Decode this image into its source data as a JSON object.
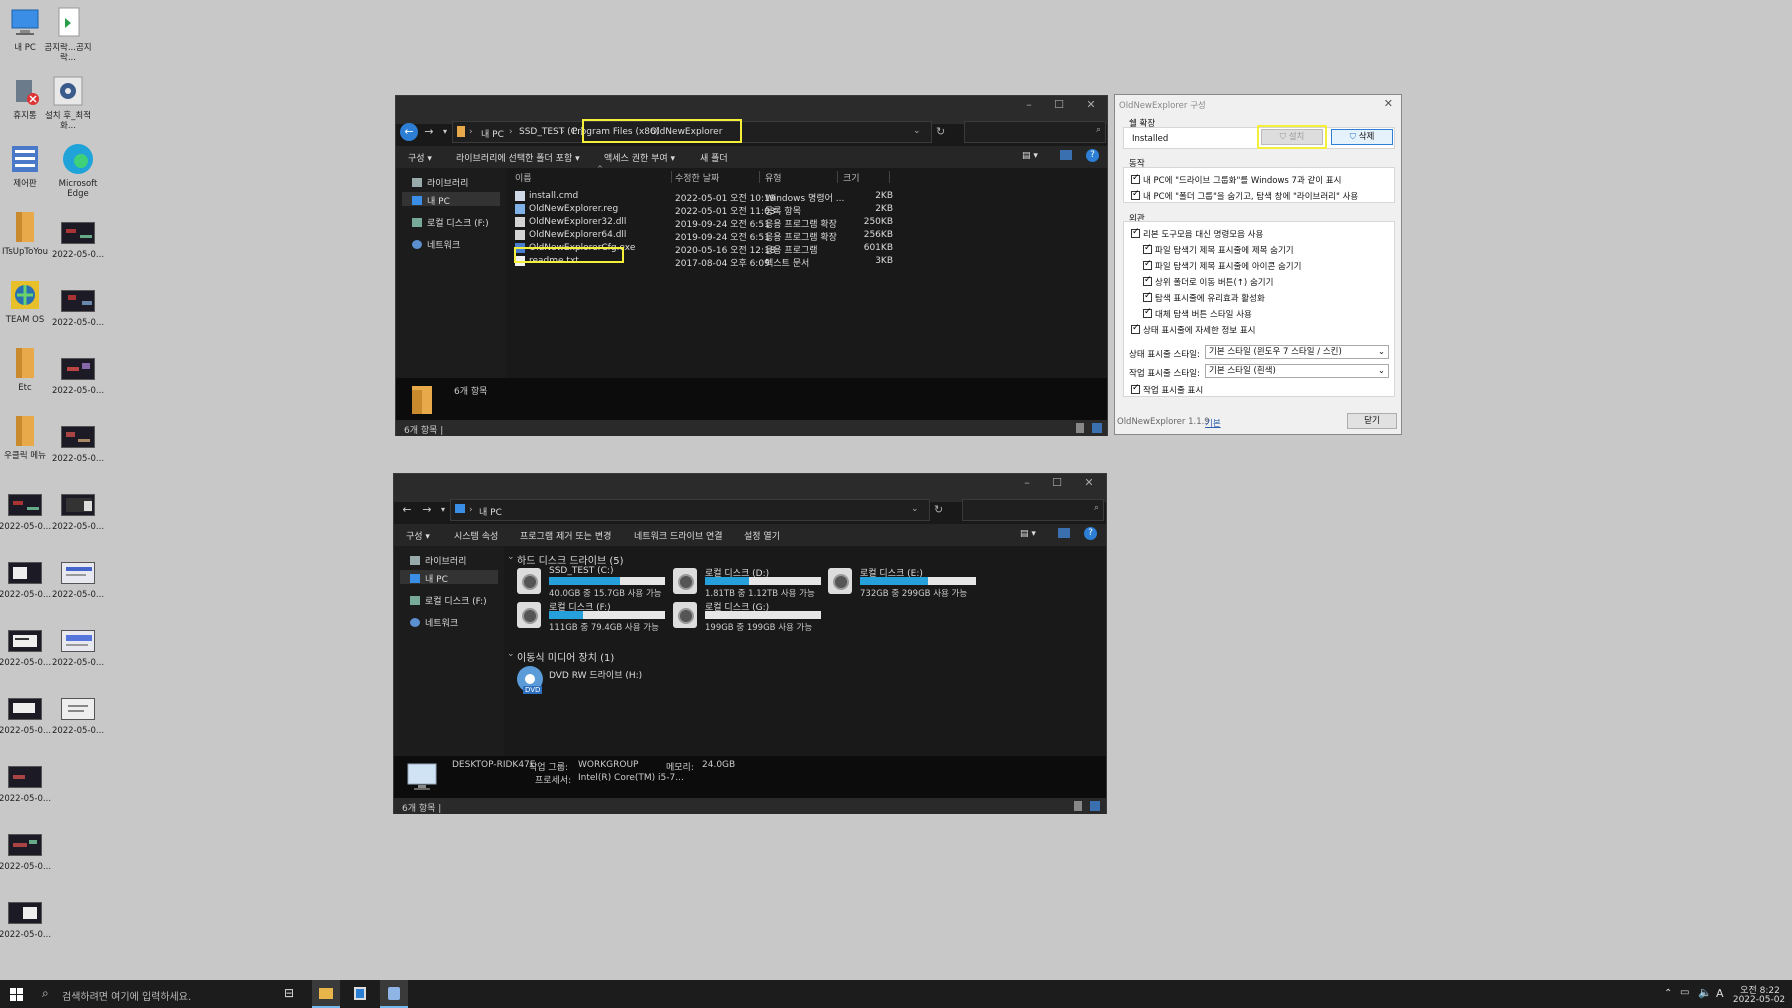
{
  "desktop": {
    "icons": [
      {
        "label": "내 PC",
        "icon": "pc-icon"
      },
      {
        "label": "곰지락...곰지락...",
        "icon": "shortcut-file-icon"
      },
      {
        "label": "휴지통",
        "icon": "recycle-bin-icon"
      },
      {
        "label": "설치 후_최적화...",
        "icon": "settings-icon"
      },
      {
        "label": "제어판",
        "icon": "control-panel-icon"
      },
      {
        "label": "Microsoft Edge",
        "icon": "edge-icon"
      },
      {
        "label": "ITsUpToYou",
        "icon": "folder-icon"
      },
      {
        "label": "TEAM OS",
        "icon": "globe-icon"
      },
      {
        "label": "Etc",
        "icon": "folder-icon"
      },
      {
        "label": "우클릭 메뉴",
        "icon": "folder-icon"
      }
    ],
    "thumb_label": "2022-05-0..."
  },
  "explorer1": {
    "breadcrumb": [
      "내 PC",
      "SSD_TEST (C:)",
      "Program Files (x86)",
      "OldNewExplorer"
    ],
    "toolbar": [
      "구성 ▾",
      "라이브러리에 선택한 폴더 포함 ▾",
      "액세스 권한 부여 ▾",
      "새 폴더"
    ],
    "nav": [
      "라이브러리",
      "내 PC",
      "로컬 디스크 (F:)",
      "네트워크"
    ],
    "columns": {
      "name": "이름",
      "date": "수정한 날짜",
      "type": "유형",
      "size": "크기"
    },
    "files": [
      {
        "name": "install.cmd",
        "date": "2022-05-01 오전 10:19",
        "type": "Windows 명령어 ...",
        "size": "2KB"
      },
      {
        "name": "OldNewExplorer.reg",
        "date": "2022-05-01 오전 11:03",
        "type": "등록 항목",
        "size": "2KB"
      },
      {
        "name": "OldNewExplorer32.dll",
        "date": "2019-09-24 오전 6:51",
        "type": "응용 프로그램 확장",
        "size": "250KB"
      },
      {
        "name": "OldNewExplorer64.dll",
        "date": "2019-09-24 오전 6:51",
        "type": "응용 프로그램 확장",
        "size": "256KB"
      },
      {
        "name": "OldNewExplorerCfg.exe",
        "date": "2020-05-16 오전 12:18",
        "type": "응용 프로그램",
        "size": "601KB"
      },
      {
        "name": "readme.txt",
        "date": "2017-08-04 오후 6:09",
        "type": "텍스트 문서",
        "size": "3KB"
      }
    ],
    "details_text": "6개 항목",
    "status": "6개 항목  |"
  },
  "explorer2": {
    "breadcrumb": [
      "내 PC"
    ],
    "toolbar": [
      "구성 ▾",
      "시스템 속성",
      "프로그램 제거 또는 변경",
      "네트워크 드라이브 연결",
      "설정 열기"
    ],
    "nav": [
      "라이브러리",
      "내 PC",
      "로컬 디스크 (F:)",
      "네트워크"
    ],
    "hdd_header": "하드 디스크 드라이브 (5)",
    "removable_header": "이동식 미디어 장치 (1)",
    "drives": [
      {
        "name": "SSD_TEST (C:)",
        "cap": "40.0GB 중 15.7GB 사용 가능",
        "used": 0.61
      },
      {
        "name": "로컬 디스크 (D:)",
        "cap": "1.81TB 중 1.12TB 사용 가능",
        "used": 0.38
      },
      {
        "name": "로컬 디스크 (E:)",
        "cap": "732GB 중 299GB 사용 가능",
        "used": 0.59
      },
      {
        "name": "로컬 디스크 (F:)",
        "cap": "111GB 중 79.4GB 사용 가능",
        "used": 0.29
      },
      {
        "name": "로컬 디스크 (G:)",
        "cap": "199GB 중 199GB 사용 가능",
        "used": 0.0
      }
    ],
    "dvd": "DVD RW 드라이브 (H:)",
    "dvd_badge": "DVD",
    "pc_name": "DESKTOP-RIDK47E",
    "workgroup_label": "작업 그룹:",
    "workgroup": "WORKGROUP",
    "memory_label": "메모리:",
    "memory": "24.0GB",
    "cpu_label": "프로세서:",
    "cpu": "Intel(R) Core(TM) i5-7...",
    "status": "6개 항목  |"
  },
  "cfg": {
    "title": "OldNewExplorer 구성",
    "shell_group": "쉘 확장",
    "installed": "Installed",
    "install_btn": "설치",
    "uninstall_btn": "삭제",
    "behavior_group": "동작",
    "behavior": [
      "내 PC에 \"드라이브 그룹화\"를 Windows 7과 같이 표시",
      "내 PC에 \"폴더 그룹\"을 숨기고, 탐색 창에 \"라이브러리\" 사용"
    ],
    "look_group": "외관",
    "look_main": "리본 도구모음 대신 명령모음 사용",
    "look_sub": [
      "파일 탐색기 제목 표시줄에 제목 숨기기",
      "파일 탐색기 제목 표시줄에 아이콘 숨기기",
      "상위 폴더로 이동 버튼(↑) 숨기기",
      "탐색 표시줄에 유리효과 활성화",
      "대체 탐색 버튼 스타일 사용"
    ],
    "look_status": "상태 표시줄에 자세한 정보 표시",
    "status_style_label": "상태 표시줄 스타일:",
    "status_style": "기본 스타일 (윈도우 7 스타일 / 스킨)",
    "task_style_label": "작업 표시줄 스타일:",
    "task_style": "기본 스타일 (흰색)",
    "show_taskbar": "작업 표시줄 표시",
    "version": "OldNewExplorer 1.1.9",
    "default_link": "기본",
    "close_btn": "닫기"
  },
  "taskbar": {
    "search_placeholder": "검색하려면 여기에 입력하세요.",
    "ime": "A",
    "time": "오전 8:22",
    "date": "2022-05-02"
  }
}
